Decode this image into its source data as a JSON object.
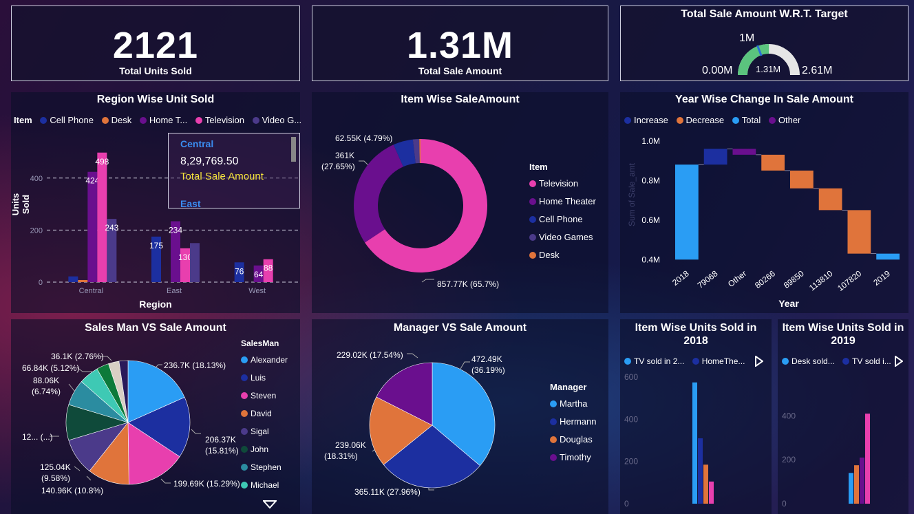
{
  "kpi": {
    "units": {
      "value": "2121",
      "label": "Total Units Sold"
    },
    "amount": {
      "value": "1.31M",
      "label": "Total Sale Amount"
    }
  },
  "gauge": {
    "title": "Total Sale Amount W.R.T. Target",
    "min_label": "0.00M",
    "max_label": "2.61M",
    "target_label": "1M",
    "value_label": "1.31M",
    "value": 1.31,
    "max": 2.61,
    "target": 1.0,
    "colors": {
      "fill": "#5bc47e",
      "track": "#e6e6e6",
      "target": "#2a6fd6"
    }
  },
  "region": {
    "title": "Region Wise Unit Sold",
    "legend_title": "Item",
    "legend": [
      {
        "label": "Cell Phone",
        "color": "#1c2fa0"
      },
      {
        "label": "Desk",
        "color": "#e0743b"
      },
      {
        "label": "Home T...",
        "color": "#6a0f8e"
      },
      {
        "label": "Television",
        "color": "#e83fae"
      },
      {
        "label": "Video G...",
        "color": "#4b3a8a"
      }
    ],
    "tooltip": {
      "header": "Central",
      "value": "8,29,769.50",
      "label": "Total Sale Amount",
      "next": "East"
    },
    "ylabel": "Units Sold",
    "xlabel": "Region"
  },
  "item_donut": {
    "title": "Item Wise SaleAmount",
    "legend_title": "Item",
    "legend": [
      {
        "label": "Television",
        "color": "#e83fae"
      },
      {
        "label": "Home Theater",
        "color": "#6a0f8e"
      },
      {
        "label": "Cell Phone",
        "color": "#1c2fa0"
      },
      {
        "label": "Video Games",
        "color": "#4b3a8a"
      },
      {
        "label": "Desk",
        "color": "#e0743b"
      }
    ],
    "labels": {
      "television": "857.77K (65.7%)",
      "home_theater_1": "361K",
      "home_theater_2": "(27.65%)",
      "cell_phone": "62.55K (4.79%)"
    }
  },
  "waterfall": {
    "title": "Year Wise Change In Sale Amount",
    "legend": [
      {
        "label": "Increase",
        "color": "#1c2fa0"
      },
      {
        "label": "Decrease",
        "color": "#e0743b"
      },
      {
        "label": "Total",
        "color": "#2a9df4"
      },
      {
        "label": "Other",
        "color": "#6a0f8e"
      }
    ],
    "ylabel": "Sum of Sale_amt",
    "xlabel": "Year"
  },
  "salesman": {
    "title": "Sales Man VS Sale Amount",
    "legend_title": "SalesMan",
    "legend": [
      {
        "label": "Alexander",
        "color": "#2a9df4"
      },
      {
        "label": "Luis",
        "color": "#1c2fa0"
      },
      {
        "label": "Steven",
        "color": "#e83fae"
      },
      {
        "label": "David",
        "color": "#e0743b"
      },
      {
        "label": "Sigal",
        "color": "#4b3a8a"
      },
      {
        "label": "John",
        "color": "#0f4a3a"
      },
      {
        "label": "Stephen",
        "color": "#2b8ca0"
      },
      {
        "label": "Michael",
        "color": "#3ec9b4"
      }
    ],
    "labels": {
      "alexander": "236.7K (18.13%)",
      "luis_1": "206.37K",
      "luis_2": "(15.81%)",
      "steven": "199.69K (15.29%)",
      "david": "140.96K (10.8%)",
      "sigal_1": "125.04K",
      "sigal_2": "(9.58%)",
      "john": "12... (...)",
      "stephen_1": "88.06K",
      "stephen_2": "(6.74%)",
      "michael": "66.84K (5.12%)",
      "other": "36.1K (2.76%)"
    }
  },
  "manager": {
    "title": "Manager VS Sale Amount",
    "legend_title": "Manager",
    "legend": [
      {
        "label": "Martha",
        "color": "#2a9df4"
      },
      {
        "label": "Hermann",
        "color": "#1c2fa0"
      },
      {
        "label": "Douglas",
        "color": "#e0743b"
      },
      {
        "label": "Timothy",
        "color": "#6a0f8e"
      }
    ],
    "labels": {
      "martha_1": "472.49K",
      "martha_2": "(36.19%)",
      "hermann": "365.11K (27.96%)",
      "douglas_1": "239.06K",
      "douglas_2": "(18.31%)",
      "timothy": "229.02K (17.54%)"
    }
  },
  "units2018": {
    "title_1": "Item Wise Units Sold in",
    "title_2": "2018",
    "legend": [
      {
        "label": "TV sold in 2...",
        "color": "#2a9df4"
      },
      {
        "label": "HomeThe...",
        "color": "#1c2fa0"
      }
    ]
  },
  "units2019": {
    "title_1": "Item Wise Units Sold in",
    "title_2": "2019",
    "legend": [
      {
        "label": "Desk sold...",
        "color": "#2a9df4"
      },
      {
        "label": "TV sold i...",
        "color": "#1c2fa0"
      }
    ]
  },
  "chart_data": [
    {
      "type": "bar",
      "title": "Region Wise Unit Sold",
      "xlabel": "Region",
      "ylabel": "Units Sold",
      "categories": [
        "Central",
        "East",
        "West"
      ],
      "ylim": [
        0,
        500
      ],
      "yticks": [
        0,
        200,
        400
      ],
      "series": [
        {
          "name": "Cell Phone",
          "color": "#1c2fa0",
          "values": [
            22,
            175,
            76
          ],
          "labels": [
            "",
            "175",
            "76"
          ]
        },
        {
          "name": "Desk",
          "color": "#e0743b",
          "values": [
            8,
            0,
            0
          ],
          "labels": [
            "",
            "",
            ""
          ]
        },
        {
          "name": "Home T...",
          "color": "#6a0f8e",
          "values": [
            424,
            234,
            64
          ],
          "labels": [
            "424",
            "234",
            "64"
          ]
        },
        {
          "name": "Television",
          "color": "#e83fae",
          "values": [
            498,
            130,
            88
          ],
          "labels": [
            "498",
            "130",
            "88"
          ]
        },
        {
          "name": "Video G...",
          "color": "#4b3a8a",
          "values": [
            243,
            150,
            0
          ],
          "labels": [
            "243",
            "",
            ""
          ]
        }
      ]
    },
    {
      "type": "pie",
      "title": "Item Wise SaleAmount",
      "donut": true,
      "slices": [
        {
          "label": "Television",
          "value": 857.77,
          "color": "#e83fae"
        },
        {
          "label": "Home Theater",
          "value": 361.0,
          "color": "#6a0f8e"
        },
        {
          "label": "Cell Phone",
          "value": 62.55,
          "color": "#1c2fa0"
        },
        {
          "label": "Video Games",
          "value": 20.0,
          "color": "#4b3a8a"
        },
        {
          "label": "Desk",
          "value": 4.0,
          "color": "#e0743b"
        }
      ]
    },
    {
      "type": "bar",
      "subtype": "waterfall",
      "title": "Year Wise Change In Sale Amount",
      "xlabel": "Year",
      "ylabel": "Sum of Sale_amt",
      "yticks": [
        "0.4M",
        "0.6M",
        "0.8M",
        "1.0M"
      ],
      "ylim": [
        0.38,
        1.02
      ],
      "categories": [
        "2018",
        "79068",
        "Other",
        "80266",
        "89850",
        "113810",
        "107820",
        "2019"
      ],
      "steps": [
        {
          "kind": "total",
          "from": 0.4,
          "to": 0.88
        },
        {
          "kind": "increase",
          "from": 0.88,
          "to": 0.96
        },
        {
          "kind": "other",
          "from": 0.96,
          "to": 0.93
        },
        {
          "kind": "decrease",
          "from": 0.93,
          "to": 0.85
        },
        {
          "kind": "decrease",
          "from": 0.85,
          "to": 0.76
        },
        {
          "kind": "decrease",
          "from": 0.76,
          "to": 0.65
        },
        {
          "kind": "decrease",
          "from": 0.65,
          "to": 0.43
        },
        {
          "kind": "total",
          "from": 0.4,
          "to": 0.43
        }
      ]
    },
    {
      "type": "pie",
      "title": "Sales Man VS Sale Amount",
      "slices": [
        {
          "label": "Alexander",
          "value": 18.13,
          "color": "#2a9df4"
        },
        {
          "label": "Luis",
          "value": 15.81,
          "color": "#1c2fa0"
        },
        {
          "label": "Steven",
          "value": 15.29,
          "color": "#e83fae"
        },
        {
          "label": "David",
          "value": 10.8,
          "color": "#e0743b"
        },
        {
          "label": "Sigal",
          "value": 9.58,
          "color": "#4b3a8a"
        },
        {
          "label": "John",
          "value": 9.2,
          "color": "#0f4a3a"
        },
        {
          "label": "Stephen",
          "value": 6.74,
          "color": "#2b8ca0"
        },
        {
          "label": "Michael",
          "value": 5.12,
          "color": "#3ec9b4"
        },
        {
          "label": "Other A",
          "value": 3.2,
          "color": "#0c7a3a"
        },
        {
          "label": "Other B",
          "value": 2.76,
          "color": "#d8cfc4"
        },
        {
          "label": "Other C",
          "value": 2.3,
          "color": "#2a1a5a"
        }
      ]
    },
    {
      "type": "pie",
      "title": "Manager VS Sale Amount",
      "slices": [
        {
          "label": "Martha",
          "value": 472.49,
          "color": "#2a9df4"
        },
        {
          "label": "Hermann",
          "value": 365.11,
          "color": "#1c2fa0"
        },
        {
          "label": "Douglas",
          "value": 239.06,
          "color": "#e0743b"
        },
        {
          "label": "Timothy",
          "value": 229.02,
          "color": "#6a0f8e"
        }
      ]
    },
    {
      "type": "bar",
      "title": "Item Wise Units Sold in 2018",
      "ylim": [
        0,
        620
      ],
      "yticks": [
        0,
        200,
        400,
        600
      ],
      "bars": [
        {
          "value": 575,
          "color": "#2a9df4"
        },
        {
          "value": 310,
          "color": "#1c2fa0"
        },
        {
          "value": 185,
          "color": "#e0743b"
        },
        {
          "value": 105,
          "color": "#e83fae"
        }
      ]
    },
    {
      "type": "bar",
      "title": "Item Wise Units Sold in 2019",
      "ylim": [
        0,
        470
      ],
      "yticks": [
        0,
        200,
        400
      ],
      "bars": [
        {
          "value": 140,
          "color": "#2a9df4"
        },
        {
          "value": 175,
          "color": "#e0743b"
        },
        {
          "value": 210,
          "color": "#6a0f8e"
        },
        {
          "value": 410,
          "color": "#e83fae"
        }
      ]
    }
  ]
}
